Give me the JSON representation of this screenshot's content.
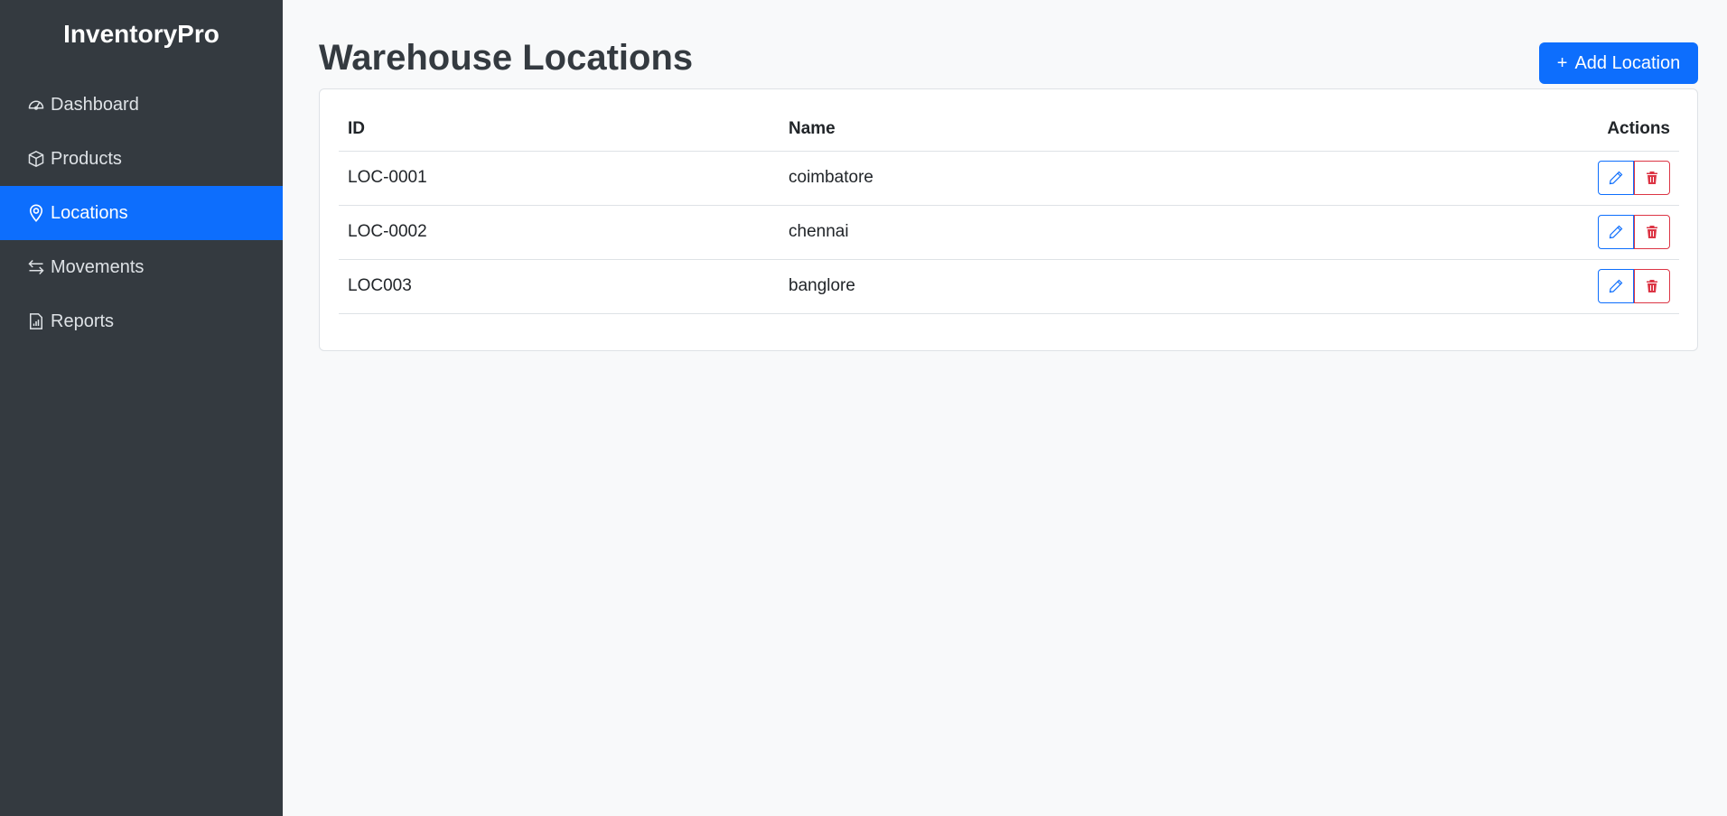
{
  "app": {
    "brand": "InventoryPro"
  },
  "sidebar": {
    "items": [
      {
        "label": "Dashboard",
        "icon": "speedometer-icon",
        "active": false
      },
      {
        "label": "Products",
        "icon": "box-icon",
        "active": false
      },
      {
        "label": "Locations",
        "icon": "map-pin-icon",
        "active": true
      },
      {
        "label": "Movements",
        "icon": "arrows-left-right-icon",
        "active": false
      },
      {
        "label": "Reports",
        "icon": "report-icon",
        "active": false
      }
    ]
  },
  "main": {
    "title": "Warehouse Locations",
    "add_button": {
      "icon": "+",
      "label": "Add Location"
    },
    "table": {
      "headers": {
        "id": "ID",
        "name": "Name",
        "actions": "Actions"
      },
      "rows": [
        {
          "id": "LOC-0001",
          "name": "coimbatore"
        },
        {
          "id": "LOC-0002",
          "name": "chennai"
        },
        {
          "id": "LOC003",
          "name": "banglore"
        }
      ]
    }
  },
  "colors": {
    "sidebar_bg": "#343a40",
    "accent": "#0d6efd",
    "danger": "#dc3545",
    "page_bg": "#f8f9fa"
  }
}
